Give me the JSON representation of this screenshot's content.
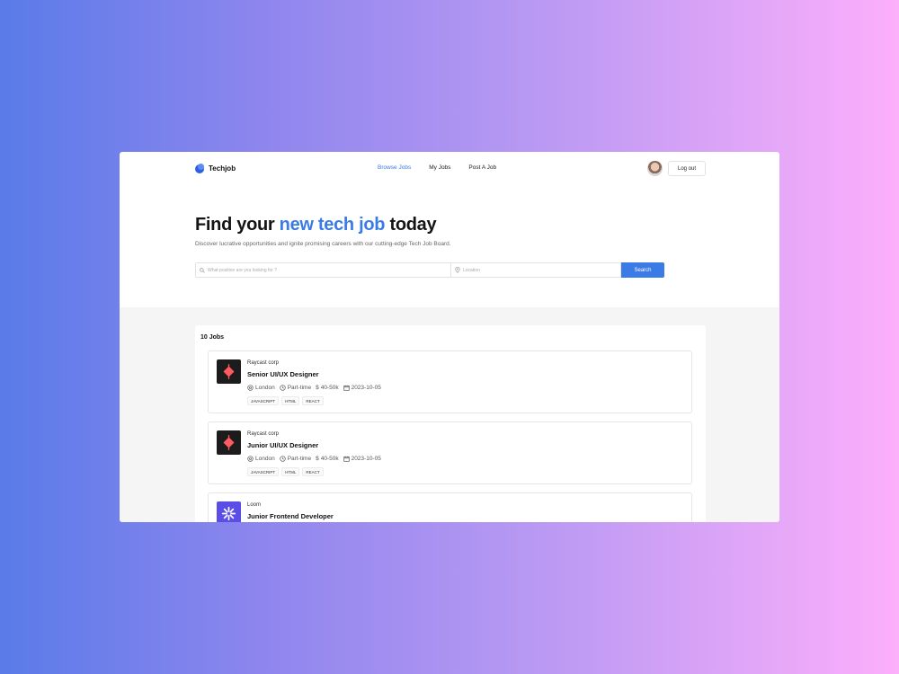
{
  "brand": {
    "name": "Techjob"
  },
  "nav": {
    "links": [
      {
        "label": "Browse Jobs",
        "active": true
      },
      {
        "label": "My Jobs",
        "active": false
      },
      {
        "label": "Post A Job",
        "active": false
      }
    ],
    "logout_label": "Log out"
  },
  "hero": {
    "title_prefix": "Find your ",
    "title_accent": "new tech job",
    "title_suffix": " today",
    "subtitle": "Discover lucrative opportunities and ignite promising careers with our cutting-edge Tech Job Board."
  },
  "search": {
    "position_placeholder": "What position are you looking for ?",
    "location_placeholder": "Location",
    "button_label": "Search"
  },
  "results": {
    "count_label": "10 Jobs",
    "jobs": [
      {
        "company": "Raycast corp",
        "title": "Senior UI/UX Designer",
        "location": "London",
        "type": "Part-time",
        "salary": "40-50k",
        "date": "2023-10-05",
        "tags": [
          "JAVASCRIPT",
          "HTML",
          "REACT"
        ],
        "logo_icon": "raycast-logo-icon"
      },
      {
        "company": "Raycast corp",
        "title": "Junior UI/UX Designer",
        "location": "London",
        "type": "Part-time",
        "salary": "40-50k",
        "date": "2023-10-05",
        "tags": [
          "JAVASCRIPT",
          "HTML",
          "REACT"
        ],
        "logo_icon": "raycast-logo-icon"
      },
      {
        "company": "Loom",
        "title": "Junior Frontend Developer",
        "logo_icon": "loom-logo-icon"
      }
    ]
  },
  "colors": {
    "accent": "#3b7be6",
    "raycast_bg": "#1c1c1c",
    "raycast_mark": "#ff5a5f",
    "loom_bg": "#5b4ee6"
  }
}
